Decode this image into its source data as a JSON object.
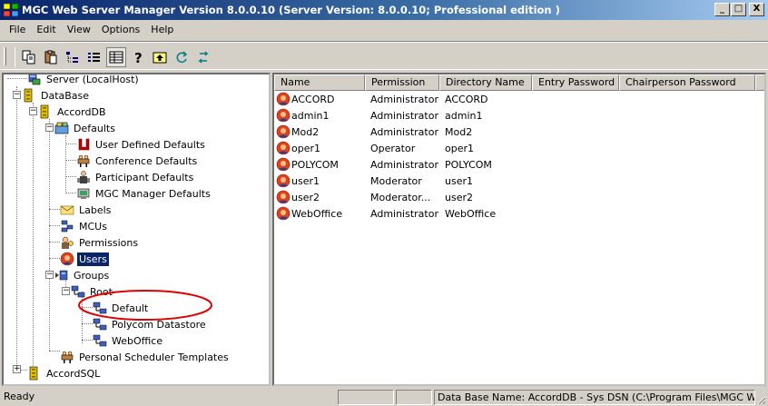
{
  "window": {
    "title": "MGC Web Server Manager Version 8.0.0.10  (Server Version: 8.0.0.10;  Professional edition )",
    "minimize": "_",
    "maximize": "□",
    "close": "X"
  },
  "menu": [
    "File",
    "Edit",
    "View",
    "Options",
    "Help"
  ],
  "toolbar": {
    "icons": [
      "copy-icon",
      "paste-icon",
      "tree-view-icon",
      "list-view-icon",
      "details-view-icon",
      "help-icon",
      "up-folder-icon",
      "refresh-icon",
      "swap-icon"
    ]
  },
  "tree": {
    "server": "Server (LocalHost)",
    "database": "DataBase",
    "accorddb": "AccordDB",
    "defaults": "Defaults",
    "user_defined_defaults": "User Defined Defaults",
    "conference_defaults": "Conference Defaults",
    "participant_defaults": "Participant Defaults",
    "mgc_manager_defaults": "MGC Manager Defaults",
    "labels": "Labels",
    "mcus": "MCUs",
    "permissions": "Permissions",
    "users": "Users",
    "groups": "Groups",
    "root": "Root",
    "default": "Default",
    "polycom_datastore": "Polycom Datastore",
    "weboffice": "WebOffice",
    "personal_scheduler_templates": "Personal Scheduler Templates",
    "accordsql": "AccordSQL"
  },
  "list": {
    "columns": [
      "Name",
      "Permission",
      "Directory Name",
      "Entry Password",
      "Chairperson Password"
    ],
    "rows": [
      {
        "name": "ACCORD",
        "permission": "Administrator",
        "directory": "ACCORD"
      },
      {
        "name": "admin1",
        "permission": "Administrator",
        "directory": "admin1"
      },
      {
        "name": "Mod2",
        "permission": "Administrator",
        "directory": "Mod2"
      },
      {
        "name": "oper1",
        "permission": "Operator",
        "directory": "oper1"
      },
      {
        "name": "POLYCOM",
        "permission": "Administrator",
        "directory": "POLYCOM"
      },
      {
        "name": "user1",
        "permission": "Moderator",
        "directory": "user1"
      },
      {
        "name": "user2",
        "permission": "Moderator...",
        "directory": "user2"
      },
      {
        "name": "WebOffice",
        "permission": "Administrator",
        "directory": "WebOffice"
      }
    ]
  },
  "status": {
    "left": "Ready",
    "db_info": "Data Base Name: AccordDB - Sys DSN (C:\\Program Files\\MGC Web"
  },
  "colors": {
    "title_active": "#0a246a",
    "selection": "#0a246a",
    "annotation": "#e00000",
    "face": "#d4d0c8"
  }
}
